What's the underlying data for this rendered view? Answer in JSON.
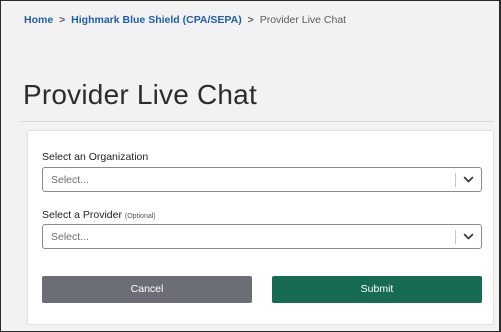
{
  "breadcrumb": {
    "home": "Home",
    "separator": ">",
    "parent": "Highmark Blue Shield (CPA/SEPA)",
    "current": "Provider Live Chat"
  },
  "page": {
    "title": "Provider Live Chat"
  },
  "form": {
    "organization": {
      "label": "Select an Organization",
      "placeholder": "Select..."
    },
    "provider": {
      "label": "Select a Provider",
      "optional_tag": "(Optional)",
      "placeholder": "Select..."
    },
    "cancel_label": "Cancel",
    "submit_label": "Submit"
  },
  "colors": {
    "link": "#1f5fa8",
    "cancel_button": "#6b6f75",
    "submit_button": "#176b55"
  },
  "icons": {
    "dropdown": "chevron-down-icon"
  }
}
